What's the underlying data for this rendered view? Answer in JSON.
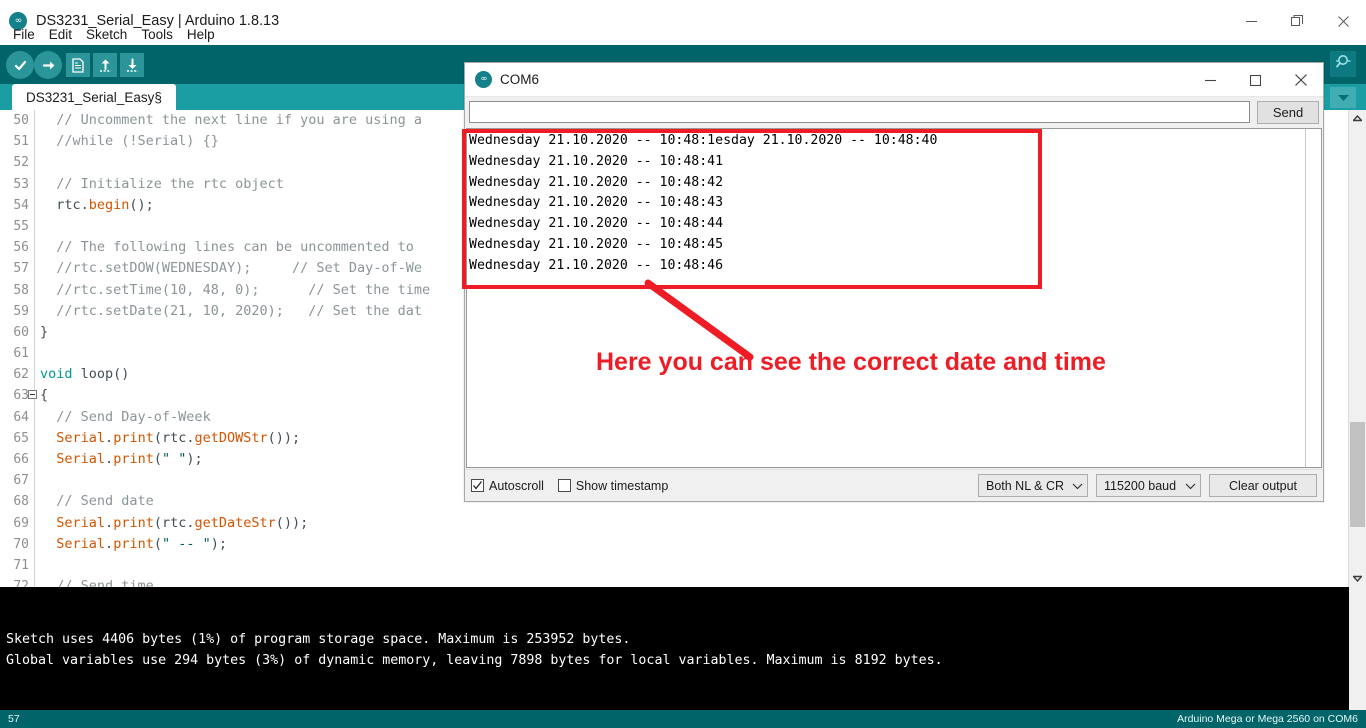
{
  "ide": {
    "title": "DS3231_Serial_Easy | Arduino 1.8.13",
    "icon": "arduino-infinity-icon",
    "menus": [
      "File",
      "Edit",
      "Sketch",
      "Tools",
      "Help"
    ],
    "toolbar": {
      "verify_label": "Verify",
      "upload_label": "Upload",
      "new_label": "New",
      "open_label": "Open",
      "save_label": "Save",
      "serial_monitor_label": "Serial Monitor"
    },
    "tab": {
      "label": "DS3231_Serial_Easy§"
    },
    "window_controls": {
      "minimize": "minimize-icon",
      "maximize": "restore-icon",
      "close": "close-icon"
    }
  },
  "editor": {
    "first_line_number": 50,
    "lines": [
      {
        "n": "50",
        "fold": false,
        "tokens": [
          {
            "t": "  ",
            "c": "plain"
          },
          {
            "t": "// Uncomment the next line if you are using a",
            "c": "cmt"
          }
        ]
      },
      {
        "n": "51",
        "fold": false,
        "tokens": [
          {
            "t": "  ",
            "c": "plain"
          },
          {
            "t": "//while (!Serial) {}",
            "c": "cmt"
          }
        ]
      },
      {
        "n": "52",
        "fold": false,
        "tokens": []
      },
      {
        "n": "53",
        "fold": false,
        "tokens": [
          {
            "t": "  ",
            "c": "plain"
          },
          {
            "t": "// Initialize the rtc object",
            "c": "cmt"
          }
        ]
      },
      {
        "n": "54",
        "fold": false,
        "tokens": [
          {
            "t": "  rtc.",
            "c": "plain"
          },
          {
            "t": "begin",
            "c": "fn"
          },
          {
            "t": "();",
            "c": "plain"
          }
        ]
      },
      {
        "n": "55",
        "fold": false,
        "tokens": []
      },
      {
        "n": "56",
        "fold": false,
        "tokens": [
          {
            "t": "  ",
            "c": "plain"
          },
          {
            "t": "// The following lines can be uncommented to",
            "c": "cmt"
          }
        ]
      },
      {
        "n": "57",
        "fold": false,
        "tokens": [
          {
            "t": "  ",
            "c": "plain"
          },
          {
            "t": "//rtc.setDOW(WEDNESDAY);     // Set Day-of-We",
            "c": "cmt"
          }
        ]
      },
      {
        "n": "58",
        "fold": false,
        "tokens": [
          {
            "t": "  ",
            "c": "plain"
          },
          {
            "t": "//rtc.setTime(10, 48, 0);      // Set the time",
            "c": "cmt"
          }
        ]
      },
      {
        "n": "59",
        "fold": false,
        "tokens": [
          {
            "t": "  ",
            "c": "plain"
          },
          {
            "t": "//rtc.setDate(21, 10, 2020);   // Set the dat",
            "c": "cmt"
          }
        ]
      },
      {
        "n": "60",
        "fold": false,
        "tokens": [
          {
            "t": "}",
            "c": "plain"
          }
        ]
      },
      {
        "n": "61",
        "fold": false,
        "tokens": []
      },
      {
        "n": "62",
        "fold": false,
        "tokens": [
          {
            "t": "void",
            "c": "kw"
          },
          {
            "t": " loop()",
            "c": "plain"
          }
        ]
      },
      {
        "n": "63",
        "fold": true,
        "tokens": [
          {
            "t": "{",
            "c": "plain"
          }
        ]
      },
      {
        "n": "64",
        "fold": false,
        "tokens": [
          {
            "t": "  ",
            "c": "plain"
          },
          {
            "t": "// Send Day-of-Week",
            "c": "cmt"
          }
        ]
      },
      {
        "n": "65",
        "fold": false,
        "tokens": [
          {
            "t": "  ",
            "c": "plain"
          },
          {
            "t": "Serial",
            "c": "fn"
          },
          {
            "t": ".",
            "c": "plain"
          },
          {
            "t": "print",
            "c": "fn"
          },
          {
            "t": "(rtc.",
            "c": "plain"
          },
          {
            "t": "getDOWStr",
            "c": "fn"
          },
          {
            "t": "());",
            "c": "plain"
          }
        ]
      },
      {
        "n": "66",
        "fold": false,
        "tokens": [
          {
            "t": "  ",
            "c": "plain"
          },
          {
            "t": "Serial",
            "c": "fn"
          },
          {
            "t": ".",
            "c": "plain"
          },
          {
            "t": "print",
            "c": "fn"
          },
          {
            "t": "(",
            "c": "plain"
          },
          {
            "t": "\" \"",
            "c": "str"
          },
          {
            "t": ");",
            "c": "plain"
          }
        ]
      },
      {
        "n": "67",
        "fold": false,
        "tokens": []
      },
      {
        "n": "68",
        "fold": false,
        "tokens": [
          {
            "t": "  ",
            "c": "plain"
          },
          {
            "t": "// Send date",
            "c": "cmt"
          }
        ]
      },
      {
        "n": "69",
        "fold": false,
        "tokens": [
          {
            "t": "  ",
            "c": "plain"
          },
          {
            "t": "Serial",
            "c": "fn"
          },
          {
            "t": ".",
            "c": "plain"
          },
          {
            "t": "print",
            "c": "fn"
          },
          {
            "t": "(rtc.",
            "c": "plain"
          },
          {
            "t": "getDateStr",
            "c": "fn"
          },
          {
            "t": "());",
            "c": "plain"
          }
        ]
      },
      {
        "n": "70",
        "fold": false,
        "tokens": [
          {
            "t": "  ",
            "c": "plain"
          },
          {
            "t": "Serial",
            "c": "fn"
          },
          {
            "t": ".",
            "c": "plain"
          },
          {
            "t": "print",
            "c": "fn"
          },
          {
            "t": "(",
            "c": "plain"
          },
          {
            "t": "\" -- \"",
            "c": "str"
          },
          {
            "t": ");",
            "c": "plain"
          }
        ]
      },
      {
        "n": "71",
        "fold": false,
        "tokens": []
      },
      {
        "n": "72",
        "fold": false,
        "tokens": [
          {
            "t": "  ",
            "c": "plain"
          },
          {
            "t": "// Send time",
            "c": "cmt"
          }
        ]
      }
    ]
  },
  "serial_monitor": {
    "title": "COM6",
    "icon": "arduino-infinity-icon",
    "input_value": "",
    "input_placeholder": "",
    "send_label": "Send",
    "output_lines": [
      "Wednesday 21.10.2020 -- 10:48:1esday 21.10.2020 -- 10:48:40",
      "Wednesday 21.10.2020 -- 10:48:41",
      "Wednesday 21.10.2020 -- 10:48:42",
      "Wednesday 21.10.2020 -- 10:48:43",
      "Wednesday 21.10.2020 -- 10:48:44",
      "Wednesday 21.10.2020 -- 10:48:45",
      "Wednesday 21.10.2020 -- 10:48:46"
    ],
    "autoscroll_label": "Autoscroll",
    "autoscroll_checked": true,
    "show_timestamp_label": "Show timestamp",
    "show_timestamp_checked": false,
    "line_ending_selected": "Both NL & CR",
    "baud_selected": "115200 baud",
    "clear_output_label": "Clear output",
    "window_controls": {
      "minimize": "minimize-icon",
      "maximize": "maximize-icon",
      "close": "close-icon"
    }
  },
  "console": {
    "lines": [
      "Sketch uses 4406 bytes (1%) of program storage space. Maximum is 253952 bytes.",
      "Global variables use 294 bytes (3%) of dynamic memory, leaving 7898 bytes for local variables. Maximum is 8192 bytes."
    ]
  },
  "statusbar": {
    "left": "57",
    "right": "Arduino Mega or Mega 2560 on COM6"
  },
  "annotation": {
    "text": "Here you can see the correct date and time",
    "color": "#ee1c25"
  },
  "colors": {
    "toolbar_teal": "#006468",
    "tabstrip_teal": "#1a9ea3",
    "accent_red": "#ee1c25",
    "console_bg": "#000000"
  }
}
